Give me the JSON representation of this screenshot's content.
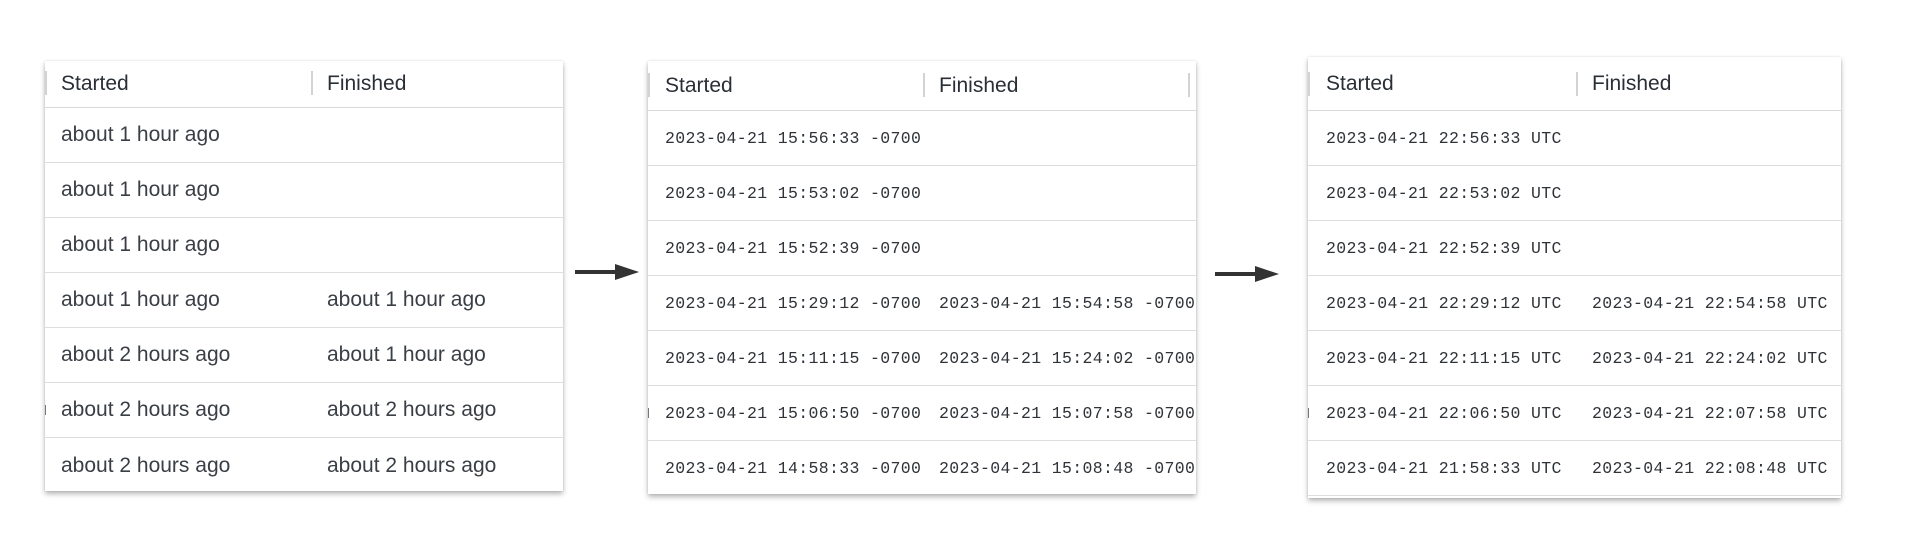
{
  "panels": [
    {
      "header": {
        "started": "Started",
        "finished": "Finished"
      },
      "rows": [
        {
          "started": "about 1 hour ago",
          "finished": ""
        },
        {
          "started": "about 1 hour ago",
          "finished": ""
        },
        {
          "started": "about 1 hour ago",
          "finished": ""
        },
        {
          "started": "about 1 hour ago",
          "finished": "about 1 hour ago"
        },
        {
          "started": "about 2 hours ago",
          "finished": "about 1 hour ago"
        },
        {
          "started": "about 2 hours ago",
          "finished": "about 2 hours ago"
        },
        {
          "started": "about 2 hours ago",
          "finished": "about 2 hours ago"
        }
      ]
    },
    {
      "header": {
        "started": "Started",
        "finished": "Finished"
      },
      "rows": [
        {
          "started": "2023-04-21 15:56:33 -0700",
          "finished": ""
        },
        {
          "started": "2023-04-21 15:53:02 -0700",
          "finished": ""
        },
        {
          "started": "2023-04-21 15:52:39 -0700",
          "finished": ""
        },
        {
          "started": "2023-04-21 15:29:12 -0700",
          "finished": "2023-04-21 15:54:58 -0700"
        },
        {
          "started": "2023-04-21 15:11:15 -0700",
          "finished": "2023-04-21 15:24:02 -0700"
        },
        {
          "started": "2023-04-21 15:06:50 -0700",
          "finished": "2023-04-21 15:07:58 -0700"
        },
        {
          "started": "2023-04-21 14:58:33 -0700",
          "finished": "2023-04-21 15:08:48 -0700"
        }
      ]
    },
    {
      "header": {
        "started": "Started",
        "finished": "Finished"
      },
      "rows": [
        {
          "started": "2023-04-21 22:56:33 UTC",
          "finished": ""
        },
        {
          "started": "2023-04-21 22:53:02 UTC",
          "finished": ""
        },
        {
          "started": "2023-04-21 22:52:39 UTC",
          "finished": ""
        },
        {
          "started": "2023-04-21 22:29:12 UTC",
          "finished": "2023-04-21 22:54:58 UTC"
        },
        {
          "started": "2023-04-21 22:11:15 UTC",
          "finished": "2023-04-21 22:24:02 UTC"
        },
        {
          "started": "2023-04-21 22:06:50 UTC",
          "finished": "2023-04-21 22:07:58 UTC"
        },
        {
          "started": "2023-04-21 21:58:33 UTC",
          "finished": "2023-04-21 22:08:48 UTC"
        }
      ]
    }
  ],
  "icons": {
    "transition": "right-arrow-icon"
  },
  "colors": {
    "text": "#3a3f46",
    "border": "#dedede",
    "arrow": "#333333"
  }
}
